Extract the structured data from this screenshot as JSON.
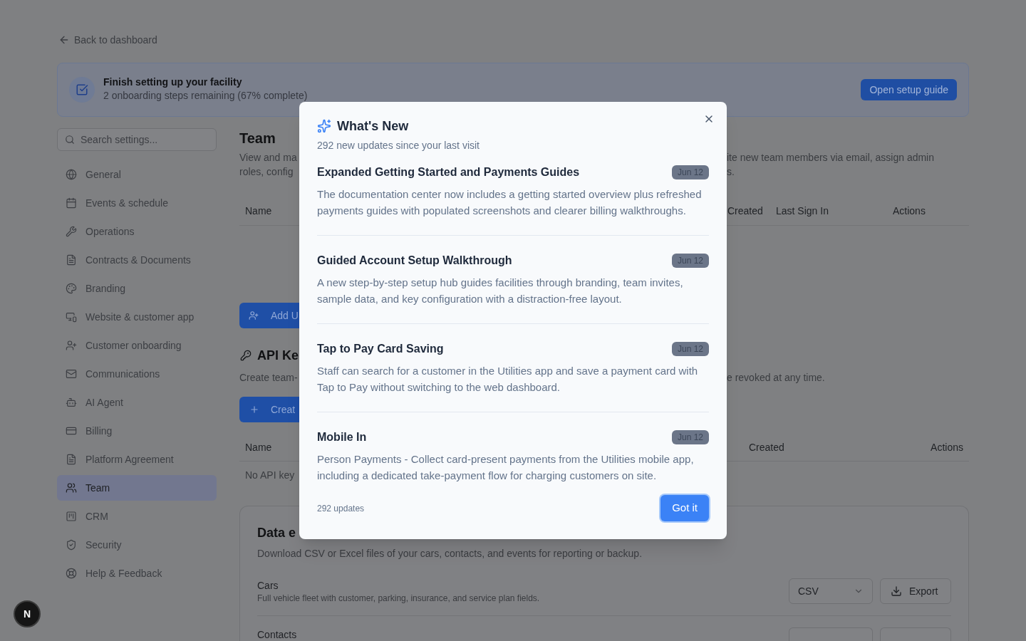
{
  "back_link": {
    "label": "Back to dashboard"
  },
  "setup_banner": {
    "title": "Finish setting up your facility",
    "subtitle": "2 onboarding steps remaining (67% complete)",
    "button": "Open setup guide"
  },
  "sidebar": {
    "search": {
      "placeholder": "Search settings..."
    },
    "items": [
      {
        "label": "General",
        "selected": false
      },
      {
        "label": "Events & schedule",
        "selected": false
      },
      {
        "label": "Operations",
        "selected": false
      },
      {
        "label": "Contracts & Documents",
        "selected": false
      },
      {
        "label": "Branding",
        "selected": false
      },
      {
        "label": "Website & customer app",
        "selected": false
      },
      {
        "label": "Customer onboarding",
        "selected": false
      },
      {
        "label": "Communications",
        "selected": false
      },
      {
        "label": "AI Agent",
        "selected": false
      },
      {
        "label": "Billing",
        "selected": false
      },
      {
        "label": "Platform Agreement",
        "selected": false
      },
      {
        "label": "Team",
        "selected": true
      },
      {
        "label": "CRM",
        "selected": false
      },
      {
        "label": "Security",
        "selected": false
      },
      {
        "label": "Help & Feedback",
        "selected": false
      }
    ]
  },
  "team": {
    "title": "Team",
    "description_left": [
      "View and ma",
      "roles, config"
    ],
    "description_right": [
      "ite new team members via email, assign admin",
      "s."
    ],
    "table": {
      "columns_left": [
        "Name"
      ],
      "columns_right": [
        "Created",
        "Last Sign In",
        "Actions"
      ]
    },
    "add_button": "Add U"
  },
  "api_keys": {
    "title": "API Ke",
    "description_left": "Create team-",
    "description_right": "e revoked at any time.",
    "create_button": "Creat",
    "table": {
      "columns_left": [
        "Name"
      ],
      "columns_right": [
        "Created",
        "Actions"
      ]
    },
    "empty_text": "No API key"
  },
  "data_export": {
    "title": "Data e",
    "description": "Download CSV or Excel files of your cars, contacts, and events for reporting or backup.",
    "rows": [
      {
        "name": "Cars",
        "description": "Full vehicle fleet with customer, parking, insurance, and service plan fields.",
        "format": "CSV",
        "action": "Export"
      },
      {
        "name": "Contacts"
      }
    ]
  },
  "whats_new": {
    "title": "What's New",
    "subtitle": "292 new updates since your last visit",
    "items": [
      {
        "title": "Expanded Getting Started and Payments Guides",
        "date": "Jun 12",
        "description": "The documentation center now includes a getting started overview plus refreshed payments guides with populated screenshots and clearer billing walkthroughs."
      },
      {
        "title": "Guided Account Setup Walkthrough",
        "date": "Jun 12",
        "description": "A new step-by-step setup hub guides facilities through branding, team invites, sample data, and key configuration with a distraction-free layout."
      },
      {
        "title": "Tap to Pay Card Saving",
        "date": "Jun 12",
        "description": "Staff can search for a customer in the Utilities app and save a payment card with Tap to Pay without switching to the web dashboard."
      },
      {
        "title": "Mobile In",
        "date": "Jun 12",
        "description": "Person Payments - Collect card-present payments from the Utilities mobile app, including a dedicated take-payment flow for charging customers on site."
      }
    ],
    "footer": "292 updates",
    "button": "Got it"
  },
  "dev_indicator": {
    "letter": "N"
  }
}
